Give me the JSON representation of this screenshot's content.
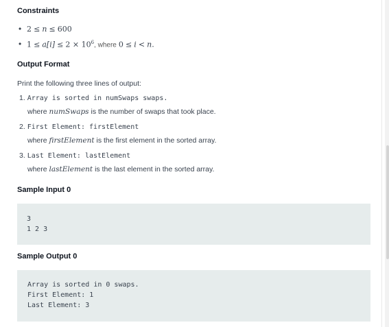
{
  "constraints": {
    "heading": "Constraints",
    "bullet1": {
      "lo": "2",
      "op1": "≤",
      "var": "n",
      "op2": "≤",
      "hi": "600"
    },
    "bullet2": {
      "lo": "1",
      "op1": "≤",
      "expr": "a[i]",
      "op2": "≤",
      "hi": "2 × 10",
      "exp": "6",
      "where": ", where",
      "lo2": "0",
      "op3": "≤",
      "var2": "i",
      "op4": "<",
      "var3": "n",
      "end": "."
    }
  },
  "output_format": {
    "heading": "Output Format",
    "intro": "Print the following three lines of output:",
    "items": [
      {
        "num": "1.",
        "code": "Array is sorted in numSwaps swaps.",
        "where": "where",
        "var": "numSwaps",
        "desc": " is the number of swaps that took place."
      },
      {
        "num": "2.",
        "code": "First Element: firstElement",
        "where": "where",
        "var": "firstElement",
        "desc": " is the first element in the sorted array."
      },
      {
        "num": "3.",
        "code": "Last Element: lastElement",
        "where": "where",
        "var": "lastElement",
        "desc": " is the last element in the sorted array."
      }
    ]
  },
  "sample_input": {
    "heading": "Sample Input 0",
    "lines": [
      "3",
      "1 2 3"
    ]
  },
  "sample_output": {
    "heading": "Sample Output 0",
    "lines": [
      "Array is sorted in 0 swaps.",
      "First Element: 1",
      "Last Element: 3"
    ]
  }
}
